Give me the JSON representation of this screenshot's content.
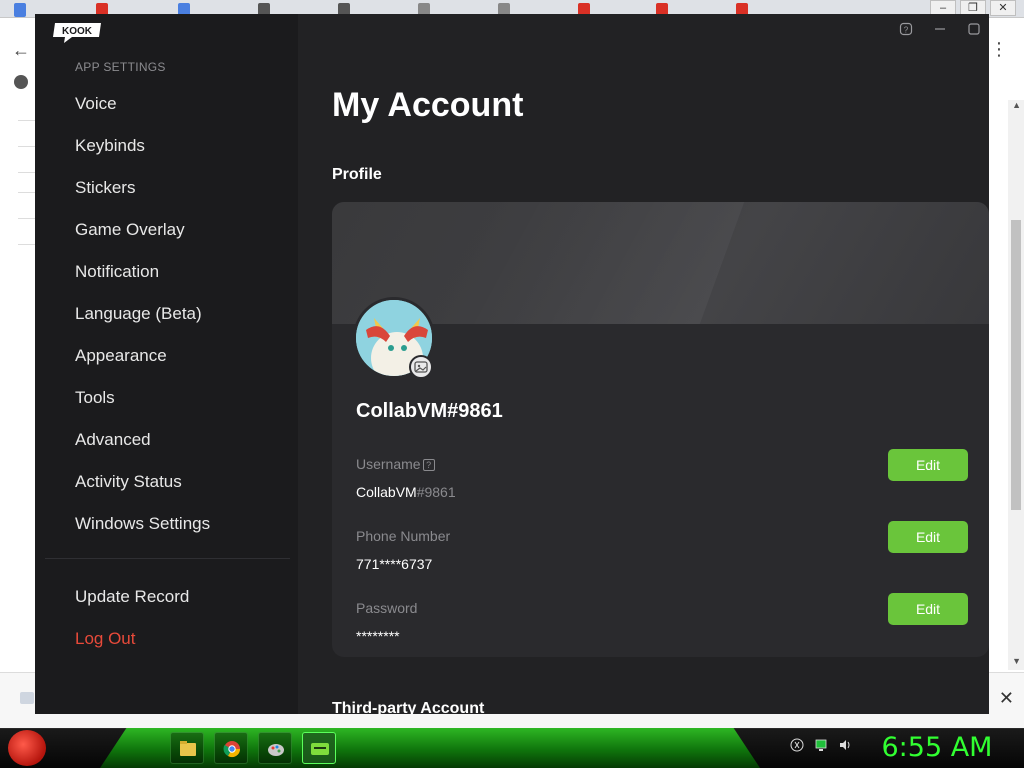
{
  "app": {
    "name": "KOOK"
  },
  "browser": {
    "back_glyph": "←",
    "menu_glyph": "⋮",
    "close_glyph": "✕"
  },
  "sidebar": {
    "section_label": "APP SETTINGS",
    "items": [
      {
        "label": "Voice"
      },
      {
        "label": "Keybinds"
      },
      {
        "label": "Stickers"
      },
      {
        "label": "Game Overlay"
      },
      {
        "label": "Notification"
      },
      {
        "label": "Language (Beta)"
      },
      {
        "label": "Appearance"
      },
      {
        "label": "Tools"
      },
      {
        "label": "Advanced"
      },
      {
        "label": "Activity Status"
      },
      {
        "label": "Windows Settings"
      }
    ],
    "footer_items": [
      {
        "label": "Update Record"
      },
      {
        "label": "Log Out"
      }
    ]
  },
  "page": {
    "title": "My Account",
    "profile_heading": "Profile",
    "third_party_heading": "Third-party Account"
  },
  "profile": {
    "display_name": "CollabVM#9861",
    "username_label": "Username",
    "username_value": "CollabVM",
    "username_tag": "#9861",
    "phone_label": "Phone Number",
    "phone_value": "771****6737",
    "password_label": "Password",
    "password_value": "********",
    "edit_label": "Edit"
  },
  "taskbar": {
    "clock": "6:55 AM"
  },
  "colors": {
    "accent_green": "#6ac53b",
    "logout_red": "#e84a3a",
    "clock_green": "#31ff31"
  }
}
